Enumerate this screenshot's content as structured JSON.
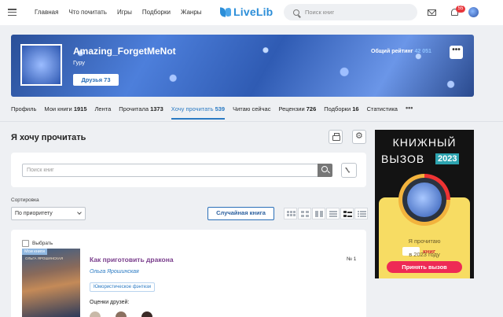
{
  "nav": {
    "links": [
      "Главная",
      "Что почитать",
      "Игры",
      "Подборки",
      "Жанры"
    ],
    "logo": "LiveLib",
    "search_placeholder": "Поиск книг",
    "notifications_count": "55"
  },
  "profile": {
    "username": "Amazing_ForgetMeNot",
    "rank": "Гуру",
    "friends_button": "Друзья 73",
    "rating_label": "Общий рейтинг",
    "rating_value": "42 051",
    "more_label": "•••"
  },
  "tabs": [
    {
      "label": "Профиль",
      "count": ""
    },
    {
      "label": "Мои книги",
      "count": "1915"
    },
    {
      "label": "Лента",
      "count": ""
    },
    {
      "label": "Прочитала",
      "count": "1373"
    },
    {
      "label": "Хочу прочитать",
      "count": "539"
    },
    {
      "label": "Читаю сейчас",
      "count": ""
    },
    {
      "label": "Рецензии",
      "count": "726"
    },
    {
      "label": "Подборки",
      "count": "16"
    },
    {
      "label": "Статистика",
      "count": ""
    }
  ],
  "tabs_more": "•••",
  "page": {
    "title": "Я хочу прочитать",
    "search_placeholder": "Поиск книг",
    "sort_label": "Сортировка",
    "sort_value": "По приоритету",
    "random_button": "Случайная книга"
  },
  "book": {
    "select_label": "Выбрать",
    "cover_tag": "Мои книги",
    "cover_author": "ОЛЬГА ЯРОШИНСКАЯ",
    "title": "Как приготовить дракона",
    "author": "Ольга Ярошинская",
    "genre": "Юмористическое фэнтези",
    "friends_ratings_label": "Оценки друзей:",
    "number": "№ 1"
  },
  "ad": {
    "line1": "КНИЖНЫЙ",
    "line2": "ВЫЗОВ",
    "year": "2023",
    "text_read": "Я прочитаю",
    "text_books": "книг",
    "text_year": "в 2023 году",
    "cta": "Принять вызов"
  }
}
